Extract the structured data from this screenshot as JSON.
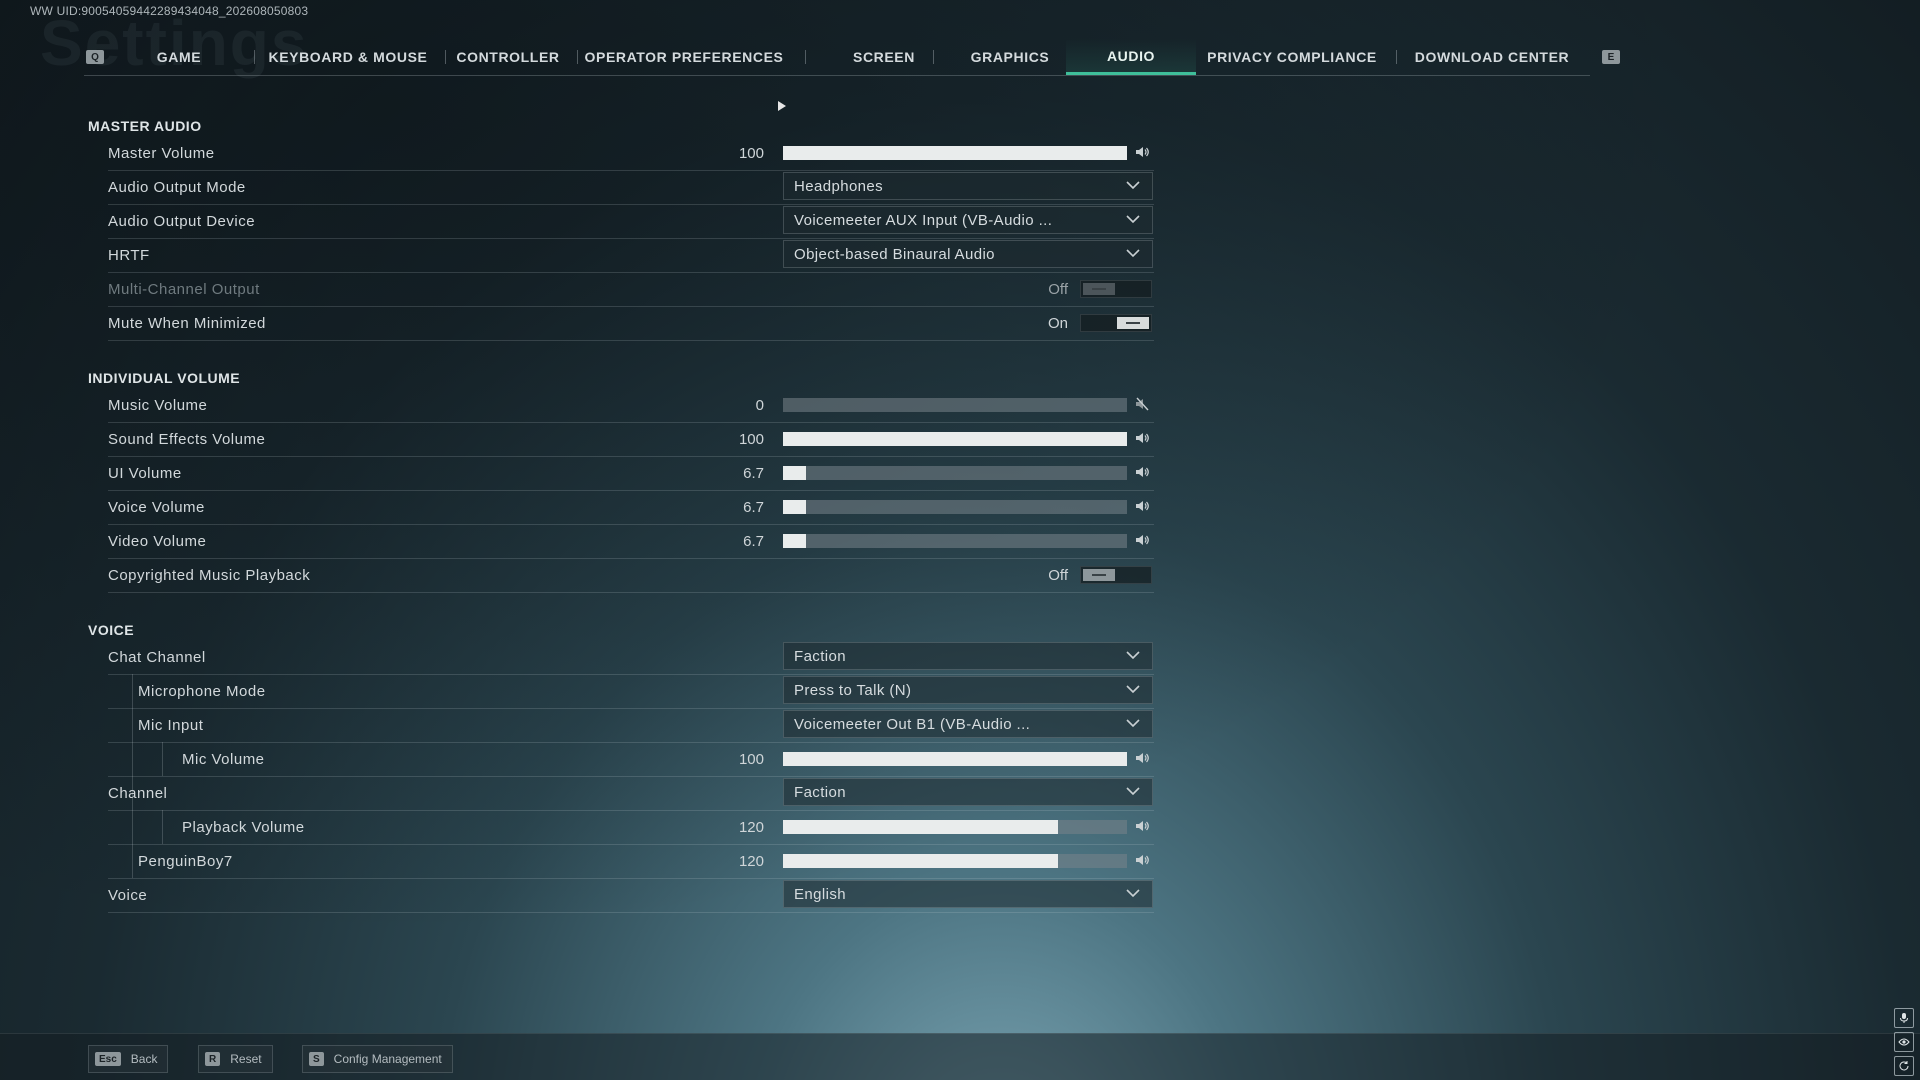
{
  "uid": "WW UID:900540594422894340​48_202608050803",
  "page_watermark": "Settings",
  "tabs": {
    "left_key": "Q",
    "right_key": "E",
    "items": [
      "GAME",
      "KEYBOARD & MOUSE",
      "CONTROLLER",
      "OPERATOR PREFERENCES",
      "SCREEN",
      "GRAPHICS",
      "AUDIO",
      "PRIVACY COMPLIANCE",
      "DOWNLOAD CENTER"
    ],
    "active": "AUDIO"
  },
  "sections": {
    "master_audio": {
      "title": "MASTER AUDIO",
      "master_volume": {
        "label": "Master Volume",
        "value": "100",
        "fill": 1.0
      },
      "output_mode": {
        "label": "Audio Output Mode",
        "selected": "Headphones"
      },
      "output_device": {
        "label": "Audio Output Device",
        "selected": "Voicemeeter AUX Input (VB-Audio ..."
      },
      "hrtf": {
        "label": "HRTF",
        "selected": "Object-based Binaural Audio"
      },
      "multi_channel": {
        "label": "Multi-Channel Output",
        "state": "Off"
      },
      "mute_minimized": {
        "label": "Mute When Minimized",
        "state": "On"
      }
    },
    "individual_volume": {
      "title": "INDIVIDUAL VOLUME",
      "music": {
        "label": "Music Volume",
        "value": "0",
        "fill": 0.0
      },
      "sfx": {
        "label": "Sound Effects Volume",
        "value": "100",
        "fill": 1.0
      },
      "ui": {
        "label": "UI Volume",
        "value": "6.7",
        "fill": 0.067
      },
      "voice": {
        "label": "Voice Volume",
        "value": "6.7",
        "fill": 0.067
      },
      "video": {
        "label": "Video Volume",
        "value": "6.7",
        "fill": 0.067
      },
      "copyrighted": {
        "label": "Copyrighted Music Playback",
        "state": "Off"
      }
    },
    "voice": {
      "title": "VOICE",
      "chat_channel": {
        "label": "Chat Channel",
        "selected": "Faction"
      },
      "mic_mode": {
        "label": "Microphone Mode",
        "selected": "Press to Talk (N)"
      },
      "mic_input": {
        "label": "Mic Input",
        "selected": "Voicemeeter Out B1 (VB-Audio ..."
      },
      "mic_volume": {
        "label": "Mic Volume",
        "value": "100",
        "fill": 1.0
      },
      "channel": {
        "label": "Channel",
        "selected": "Faction"
      },
      "playback_volume": {
        "label": "Playback Volume",
        "value": "120",
        "fill": 0.8
      },
      "penguinboy": {
        "label": "PenguinBoy7",
        "value": "120",
        "fill": 0.8
      },
      "voice_lang": {
        "label": "Voice",
        "selected": "English"
      }
    }
  },
  "bottom": {
    "back": {
      "key": "Esc",
      "label": "Back"
    },
    "reset": {
      "key": "R",
      "label": "Reset"
    },
    "config": {
      "key": "S",
      "label": "Config Management"
    }
  },
  "icons": {
    "speaker": "speaker-icon",
    "muted": "speaker-muted-icon",
    "chevron": "chevron-down-icon"
  }
}
